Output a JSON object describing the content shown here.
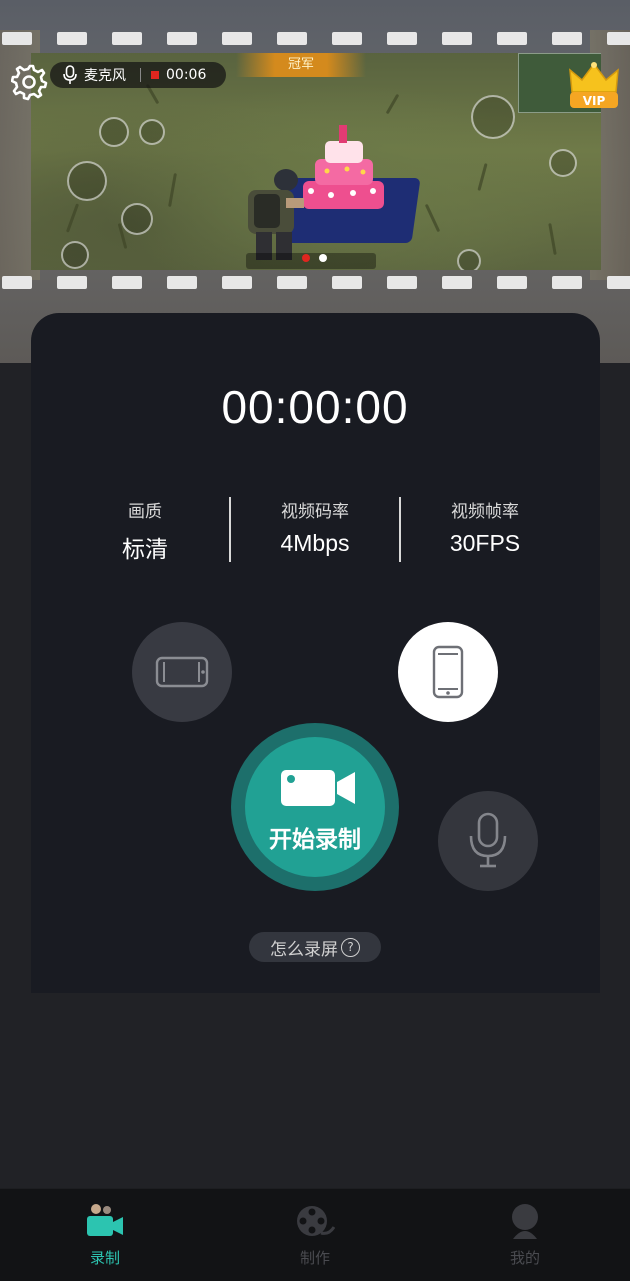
{
  "preview": {
    "overlay": {
      "mic_label": "麦克风",
      "rec_time": "00:06"
    },
    "game_banner": "冠军",
    "vip_badge": "VIP"
  },
  "recorder": {
    "timer": "00:00:00",
    "stats": [
      {
        "label": "画质",
        "value": "标清"
      },
      {
        "label": "视频码率",
        "value": "4Mbps"
      },
      {
        "label": "视频帧率",
        "value": "30FPS"
      }
    ],
    "record_button_label": "开始录制",
    "howto_label": "怎么录屏",
    "howto_icon": "?",
    "selected_orientation": "portrait",
    "colors": {
      "accent": "#21a194",
      "accent_ring": "#1d6f6b",
      "tab_active": "#2cc4b0",
      "panel_bg": "#191b22"
    }
  },
  "tabbar": {
    "tabs": [
      {
        "label": "录制",
        "icon": "camera-icon",
        "active": true
      },
      {
        "label": "制作",
        "icon": "film-reel-icon",
        "active": false
      },
      {
        "label": "我的",
        "icon": "profile-icon",
        "active": false
      }
    ]
  }
}
